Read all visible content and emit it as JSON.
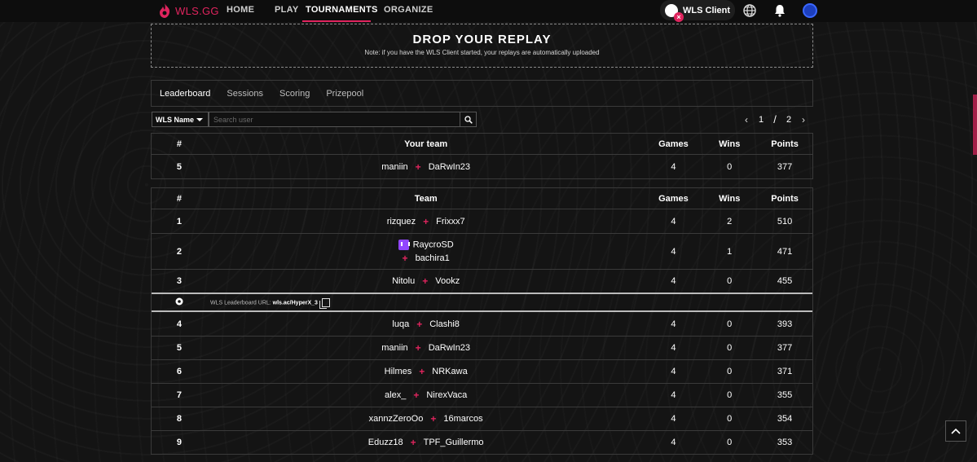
{
  "brand": {
    "name": "WLS.GG",
    "accent": "#e0245e"
  },
  "nav": {
    "items": [
      "HOME",
      "PLAY",
      "TOURNAMENTS",
      "ORGANIZE"
    ],
    "active": "TOURNAMENTS"
  },
  "client": {
    "label": "WLS Client",
    "status_icon": "close-icon"
  },
  "drop": {
    "title": "DROP YOUR REPLAY",
    "note": "Note: if you have the WLS Client started, your replays are automatically uploaded"
  },
  "tabs": [
    "Leaderboard",
    "Sessions",
    "Scoring",
    "Prizepool"
  ],
  "filter": {
    "selected": "WLS Name"
  },
  "search": {
    "placeholder": "Search user",
    "value": ""
  },
  "pager": {
    "current": "1",
    "separator": "/",
    "total": "2"
  },
  "your_team": {
    "headers": {
      "rank": "#",
      "team": "Your team",
      "games": "Games",
      "wins": "Wins",
      "points": "Points"
    },
    "row": {
      "rank": "5",
      "players": [
        "maniin",
        "DaRwIn23"
      ],
      "games": "4",
      "wins": "0",
      "points": "377"
    }
  },
  "leaderboard": {
    "headers": {
      "rank": "#",
      "team": "Team",
      "games": "Games",
      "wins": "Wins",
      "points": "Points"
    },
    "rows_top": [
      {
        "rank": "1",
        "players": [
          "rizquez",
          "Frixxx7"
        ],
        "games": "4",
        "wins": "2",
        "points": "510"
      },
      {
        "rank": "2",
        "players": [
          "RaycroSD",
          "bachira1"
        ],
        "games": "4",
        "wins": "1",
        "points": "471"
      },
      {
        "rank": "3",
        "players": [
          "Nitolu",
          "Vookz"
        ],
        "games": "4",
        "wins": "0",
        "points": "455"
      }
    ],
    "url_row": {
      "label": "WLS Leaderboard URL:",
      "value": "wls.ac/HyperX_3"
    },
    "rows_bottom": [
      {
        "rank": "4",
        "players": [
          "luqa",
          "Clashi8"
        ],
        "games": "4",
        "wins": "0",
        "points": "393"
      },
      {
        "rank": "5",
        "players": [
          "maniin",
          "DaRwIn23"
        ],
        "games": "4",
        "wins": "0",
        "points": "377"
      },
      {
        "rank": "6",
        "players": [
          "Hilmes",
          "NRKawa"
        ],
        "games": "4",
        "wins": "0",
        "points": "371"
      },
      {
        "rank": "7",
        "players": [
          "alex_",
          "NirexVaca"
        ],
        "games": "4",
        "wins": "0",
        "points": "355"
      },
      {
        "rank": "8",
        "players": [
          "xannzZeroOo",
          "16marcos"
        ],
        "games": "4",
        "wins": "0",
        "points": "354"
      },
      {
        "rank": "9",
        "players": [
          "Eduzz18",
          "TPF_Guillermo"
        ],
        "games": "4",
        "wins": "0",
        "points": "353"
      }
    ]
  }
}
